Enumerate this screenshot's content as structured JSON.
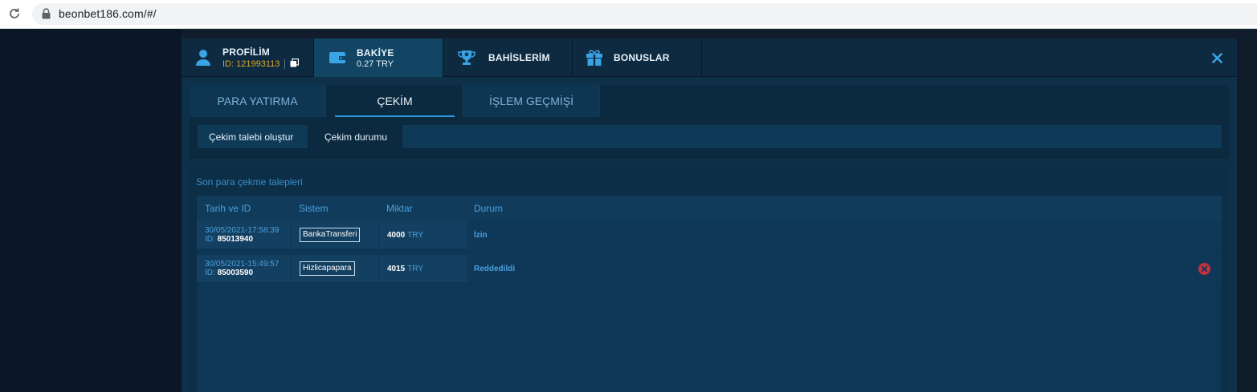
{
  "browser": {
    "url": "beonbet186.com/#/"
  },
  "header": {
    "profile": {
      "title": "PROFİLİM",
      "id_text": "ID: 121993113"
    },
    "balance": {
      "title": "BAKİYE",
      "value": "0.27 TRY"
    },
    "bets": {
      "title": "BAHİSLERİM"
    },
    "bonuses": {
      "title": "BONUSLAR"
    }
  },
  "tabs": [
    {
      "label": "PARA YATIRMA",
      "active": false
    },
    {
      "label": "ÇEKİM",
      "active": true
    },
    {
      "label": "İŞLEM GEÇMİŞİ",
      "active": false
    }
  ],
  "subtabs": [
    {
      "label": "Çekim talebi oluştur",
      "active": false
    },
    {
      "label": "Çekim durumu",
      "active": true
    }
  ],
  "requests": {
    "title": "Son para çekme talepleri",
    "columns": [
      "Tarih ve ID",
      "Sistem",
      "Miktar",
      "Durum"
    ],
    "rows": [
      {
        "date": "30/05/2021-17:58:39",
        "id_prefix": "ID:",
        "id": "85013940",
        "system": "BankaTransferi",
        "amount": "4000",
        "currency": "TRY",
        "status": "İzin",
        "cancelable": false
      },
      {
        "date": "30/05/2021-15:49:57",
        "id_prefix": "ID:",
        "id": "85003590",
        "system": "Hizlicapapara",
        "amount": "4015",
        "currency": "TRY",
        "status": "Reddedildi",
        "cancelable": true
      }
    ]
  },
  "colors": {
    "accent": "#2e9be0",
    "id_gold": "#e0a82e",
    "cancel_red": "#c8303c",
    "modal_bg": "#0e3049"
  },
  "icons": {
    "reload": "reload-icon",
    "lock": "lock-icon",
    "profile": "user-icon",
    "copy": "copy-icon",
    "balance": "wallet-icon",
    "bets": "trophy-icon",
    "bonuses": "gift-icon",
    "close": "close-icon",
    "cancel": "cancel-circle-icon"
  }
}
